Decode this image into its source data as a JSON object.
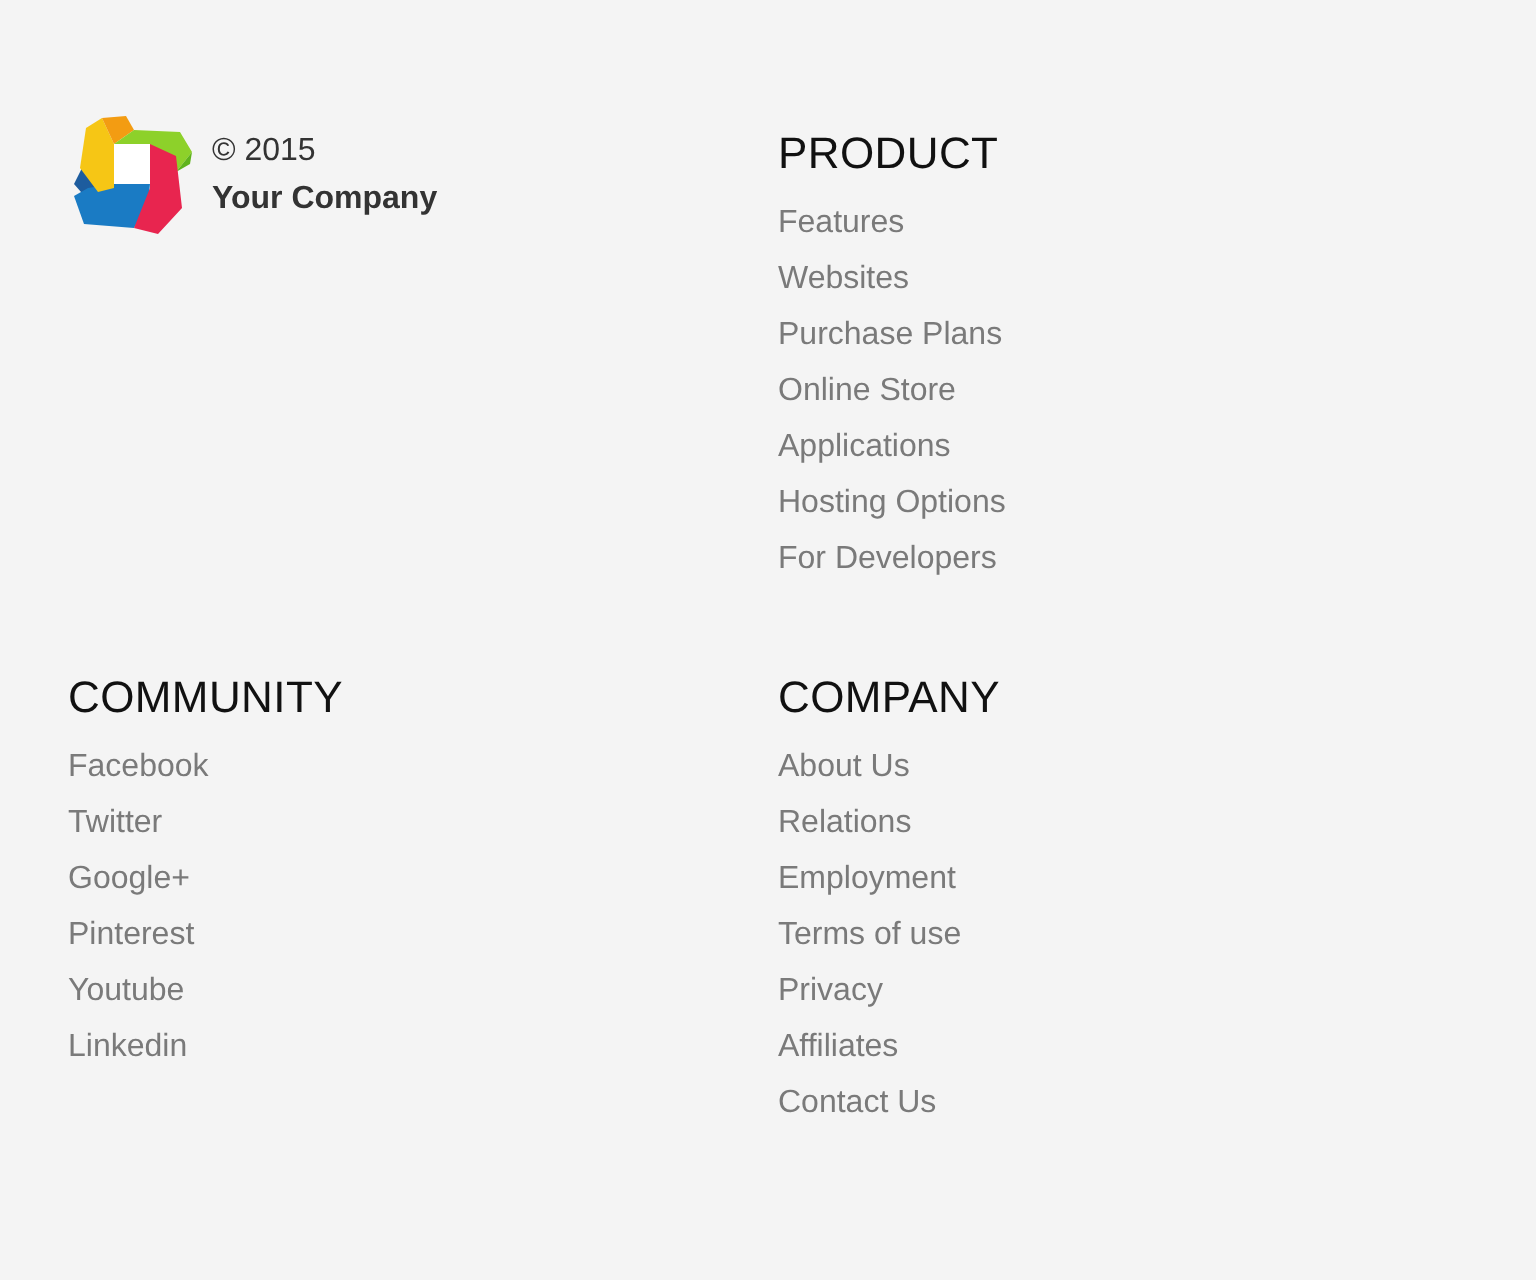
{
  "brand": {
    "copyright": "© 2015",
    "company": "Your Company"
  },
  "sections": [
    {
      "title": "PRODUCT",
      "links": [
        "Features",
        "Websites",
        "Purchase Plans",
        "Online Store",
        "Applications",
        "Hosting Options",
        "For Developers"
      ]
    },
    {
      "title": "COMMUNITY",
      "links": [
        "Facebook",
        "Twitter",
        "Google+",
        "Pinterest",
        "Youtube",
        "Linkedin"
      ]
    },
    {
      "title": "COMPANY",
      "links": [
        "About Us",
        "Relations",
        "Employment",
        "Terms of use",
        "Privacy",
        "Affiliates",
        "Contact Us"
      ]
    }
  ]
}
